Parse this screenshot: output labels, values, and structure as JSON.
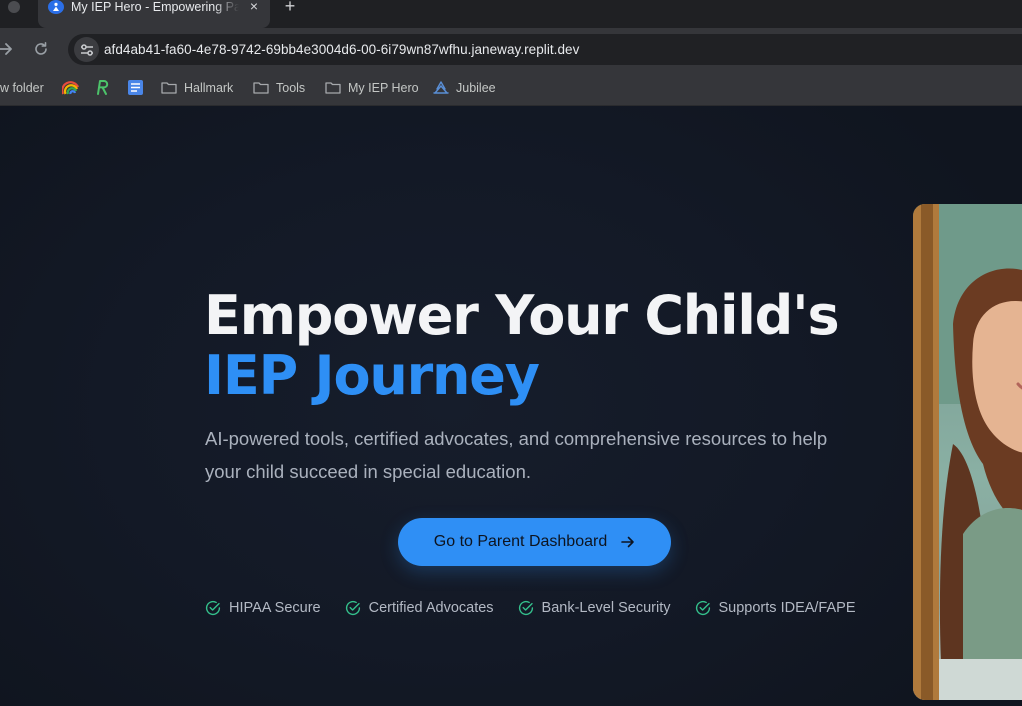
{
  "browser": {
    "active_tab_title": "My IEP Hero - Empowering Parents",
    "new_tab_label": "+",
    "close_tab_label": "×",
    "url": "afd4ab41-fa60-4e78-9742-69bb4e3004d6-00-6i79wn87wfhu.janeway.replit.dev"
  },
  "bookmarks": [
    {
      "label": "w folder",
      "icon": "folder-icon"
    },
    {
      "label": "",
      "icon": "rainbow-app-icon"
    },
    {
      "label": "",
      "icon": "green-r-app-icon"
    },
    {
      "label": "",
      "icon": "docs-icon"
    },
    {
      "label": "Hallmark",
      "icon": "folder-icon"
    },
    {
      "label": "Tools",
      "icon": "folder-icon"
    },
    {
      "label": "My IEP Hero",
      "icon": "folder-icon"
    },
    {
      "label": "Jubilee",
      "icon": "jubilee-logo-icon"
    }
  ],
  "hero": {
    "title_line1": "Empower Your Child's",
    "title_line2": "IEP Journey",
    "subtitle": "AI-powered tools, certified advocates, and comprehensive resources to help your child succeed in special education.",
    "cta_label": "Go to Parent Dashboard",
    "features": [
      "HIPAA Secure",
      "Certified Advocates",
      "Bank-Level Security",
      "Supports IDEA/FAPE"
    ]
  },
  "colors": {
    "accent": "#2f8ff5",
    "page_background": "#121722",
    "check_green": "#34c08c"
  }
}
